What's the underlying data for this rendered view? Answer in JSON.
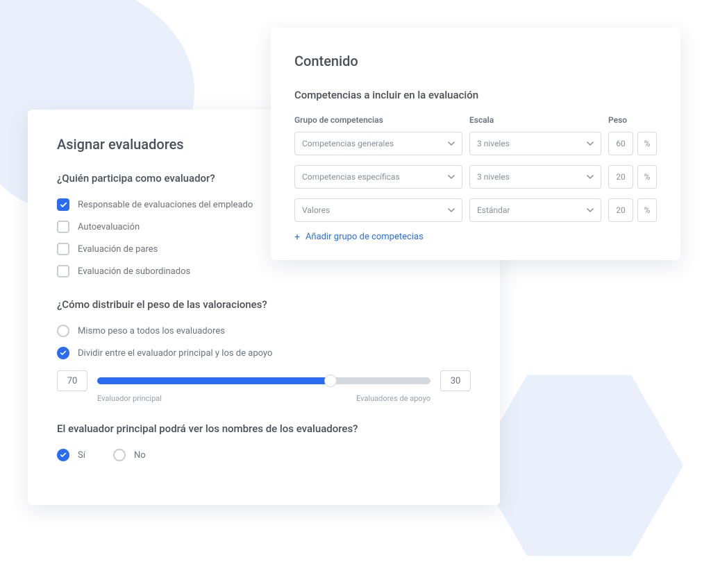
{
  "assign": {
    "title": "Asignar evaluadores",
    "q_who": "¿Quién participa como evaluador?",
    "who_options": [
      "Responsable de evaluaciones del empleado",
      "Autoevaluación",
      "Evaluación de pares",
      "Evaluación de subordinados"
    ],
    "q_weight": "¿Cómo distribuir el peso de las valoraciones?",
    "weight_options": [
      "Mismo peso a todos los evaluadores",
      "Dividir entre el evaluador principal y los de apoyo"
    ],
    "slider_left": "70",
    "slider_right": "30",
    "slider_label_left": "Evaluador principal",
    "slider_label_right": "Evaluadores de apoyo",
    "q_names": "El evaluador principal podrá ver los nombres de los evaluadores?",
    "yes": "Sí",
    "no": "No"
  },
  "content": {
    "title": "Contenido",
    "subtitle": "Competencias a incluir en la evaluación",
    "col_group": "Grupo de competencias",
    "col_scale": "Escala",
    "col_weight": "Peso",
    "pct": "%",
    "rows": [
      {
        "group": "Competencias generales",
        "scale": "3 niveles",
        "weight": "60"
      },
      {
        "group": "Competencias específicas",
        "scale": "3 niveles",
        "weight": "20"
      },
      {
        "group": "Valores",
        "scale": "Estándar",
        "weight": "20"
      }
    ],
    "add_link": "Añadir grupo de competecias"
  }
}
